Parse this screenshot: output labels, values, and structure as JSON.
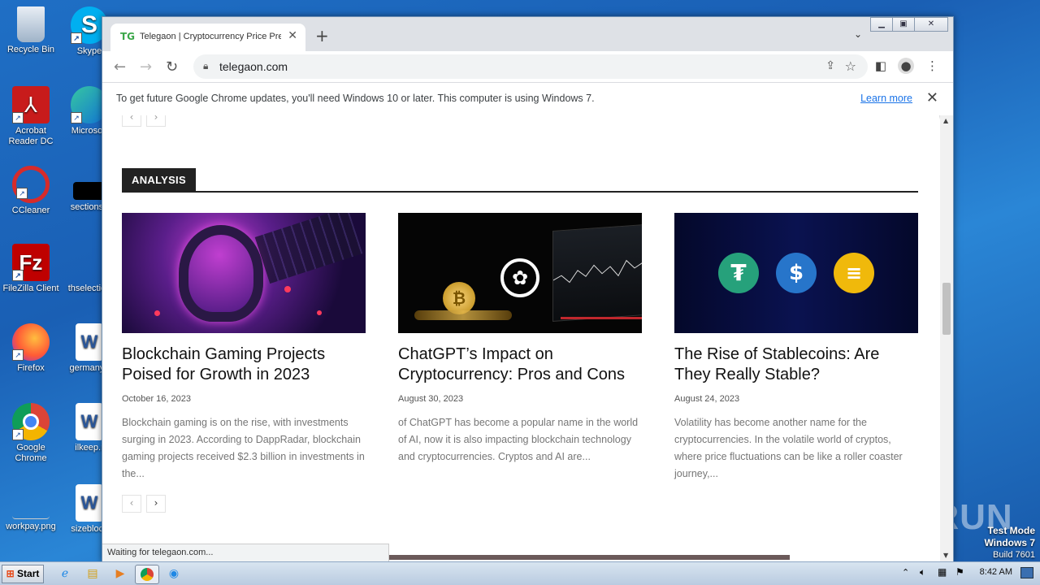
{
  "desktop": {
    "icons": [
      {
        "label": "Recycle Bin"
      },
      {
        "label": "Skype"
      },
      {
        "label": "Acrobat Reader DC"
      },
      {
        "label": "Microsoft"
      },
      {
        "label": "CCleaner"
      },
      {
        "label": "sectionsn"
      },
      {
        "label": "FileZilla Client"
      },
      {
        "label": "thselection"
      },
      {
        "label": "Firefox"
      },
      {
        "label": "germanyn"
      },
      {
        "label": "Google Chrome"
      },
      {
        "label": "ilkeep.r"
      },
      {
        "label": "workpay.png"
      },
      {
        "label": "sizeblock"
      }
    ],
    "test_mode": {
      "line1": "Test Mode",
      "line2": "Windows 7",
      "line3": "Build 7601"
    },
    "watermark": "ANY RUN"
  },
  "browser": {
    "tab_title": "Telegaon | Cryptocurrency Price Pre",
    "tab_favicon": "TG",
    "url": "telegaon.com",
    "infobar": {
      "message": "To get future Google Chrome updates, you'll need Windows 10 or later. This computer is using Windows 7.",
      "link": "Learn more"
    },
    "status": "Waiting for telegaon.com..."
  },
  "page": {
    "section_label": "ANALYSIS",
    "articles": [
      {
        "title": "Blockchain Gaming Projects Poised for Growth in 2023",
        "date": "October 16, 2023",
        "excerpt": "Blockchain gaming is on the rise, with investments surging in 2023. According to DappRadar, blockchain gaming projects received $2.3 billion in investments in the..."
      },
      {
        "title": "ChatGPT’s Impact on Cryptocurrency: Pros and Cons",
        "date": "August 30, 2023",
        "excerpt": "of ChatGPT has become a popular name in the world of AI, now it is also impacting blockchain technology and cryptocurrencies. Cryptos and AI are..."
      },
      {
        "title": "The Rise of Stablecoins: Are They Really Stable?",
        "date": "August 24, 2023",
        "excerpt": "Volatility has become another name for the cryptocurrencies. In the volatile world of cryptos, where price fluctuations can be like a roller coaster journey,..."
      }
    ],
    "pager_prev": "‹",
    "pager_next": "›"
  },
  "taskbar": {
    "start_label": "Start",
    "clock": "8:42 AM"
  },
  "colors": {
    "section_bg": "#222222",
    "link": "#1a73e8",
    "tether": "#26a17b",
    "usdc": "#2775ca",
    "binance": "#f0b90b"
  }
}
